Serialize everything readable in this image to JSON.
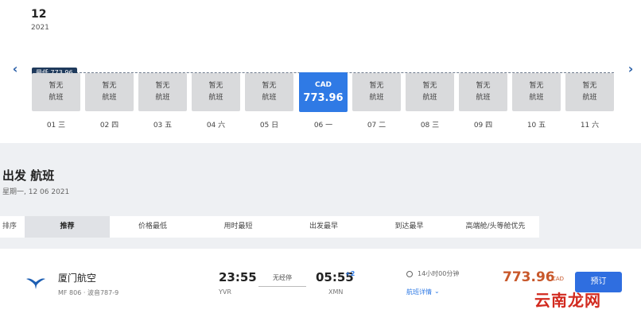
{
  "calendar": {
    "month": "12",
    "year": "2021",
    "lowest_tag": "最低 773.96",
    "prev_arrow": "‹",
    "next_arrow": "›",
    "days": [
      {
        "line1": "暂无",
        "line2": "航班",
        "label": "01 三"
      },
      {
        "line1": "暂无",
        "line2": "航班",
        "label": "02 四"
      },
      {
        "line1": "暂无",
        "line2": "航班",
        "label": "03 五"
      },
      {
        "line1": "暂无",
        "line2": "航班",
        "label": "04 六"
      },
      {
        "line1": "暂无",
        "line2": "航班",
        "label": "05 日"
      },
      {
        "line1": "CAD",
        "line2": "773.96",
        "label": "06 一"
      },
      {
        "line1": "暂无",
        "line2": "航班",
        "label": "07 二"
      },
      {
        "line1": "暂无",
        "line2": "航班",
        "label": "08 三"
      },
      {
        "line1": "暂无",
        "line2": "航班",
        "label": "09 四"
      },
      {
        "line1": "暂无",
        "line2": "航班",
        "label": "10 五"
      },
      {
        "line1": "暂无",
        "line2": "航班",
        "label": "11 六"
      }
    ]
  },
  "section": {
    "title": "出发 航班",
    "date": "星期一, 12 06 2021"
  },
  "sort": {
    "label": "排序",
    "tabs": [
      "推荐",
      "价格最低",
      "用时最短",
      "出发最早",
      "到达最早",
      "高端舱/头等舱优先"
    ]
  },
  "flight": {
    "airline": "厦门航空",
    "flight_no": "MF 806 · 波音787-9",
    "dep_time": "23:55",
    "dep_code": "YVR",
    "stop_text": "无经停",
    "arr_time": "05:55",
    "arr_plus": "+2",
    "arr_code": "XMN",
    "duration": "14小时00分钟",
    "detail_link": "航班详情",
    "detail_caret": "⌄",
    "price": "773.96",
    "currency": "CAD",
    "book_label": "预订"
  },
  "watermark": "云南龙网",
  "colors": {
    "accent": "#2f7ae5",
    "price": "#c8582b",
    "page_bg": "#eef0f3"
  }
}
